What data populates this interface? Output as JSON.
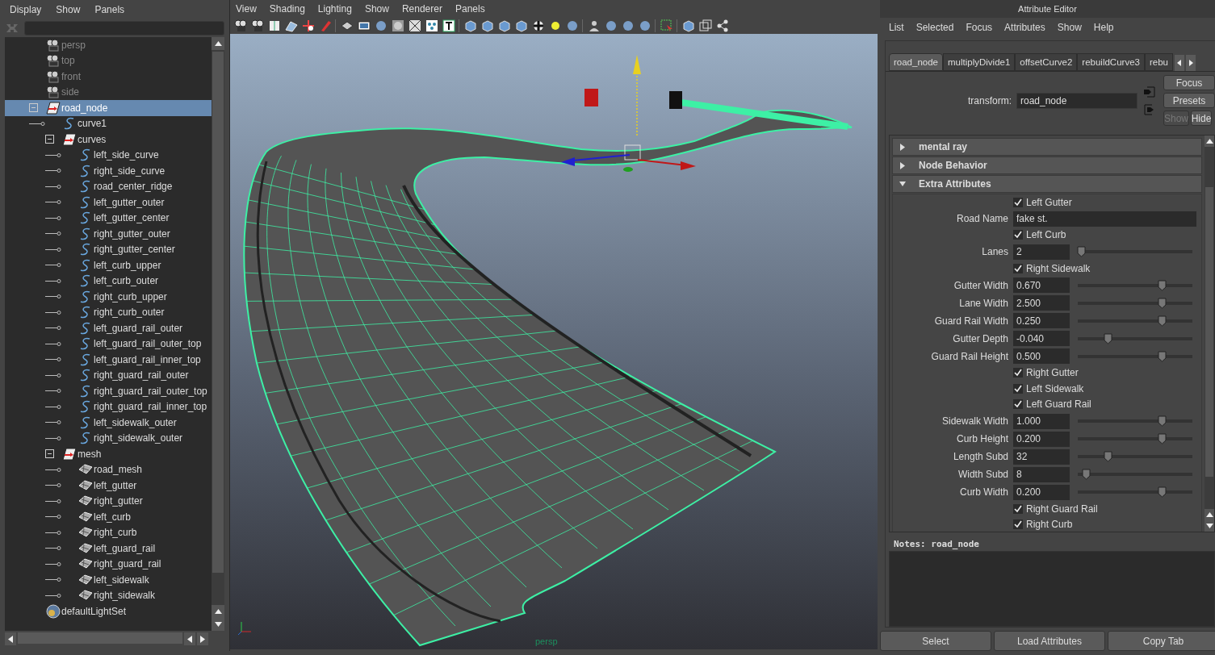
{
  "outliner": {
    "menu": [
      "Display",
      "Show",
      "Panels"
    ],
    "tree": [
      {
        "name": "persp",
        "kind": "camera",
        "selected": false
      },
      {
        "name": "top",
        "kind": "camera",
        "selected": false
      },
      {
        "name": "front",
        "kind": "camera",
        "selected": false
      },
      {
        "name": "side",
        "kind": "camera",
        "selected": false
      },
      {
        "name": "road_node",
        "kind": "transform",
        "selected": true,
        "expanded": true,
        "children": [
          {
            "name": "curve1",
            "kind": "curve",
            "selected": false
          },
          {
            "name": "curves",
            "kind": "transform",
            "selected": false,
            "expanded": true,
            "children": [
              {
                "name": "left_side_curve",
                "kind": "curve",
                "selected": false
              },
              {
                "name": "right_side_curve",
                "kind": "curve",
                "selected": false
              },
              {
                "name": "road_center_ridge",
                "kind": "curve",
                "selected": false
              },
              {
                "name": "left_gutter_outer",
                "kind": "curve",
                "selected": false
              },
              {
                "name": "left_gutter_center",
                "kind": "curve",
                "selected": false
              },
              {
                "name": "right_gutter_outer",
                "kind": "curve",
                "selected": false
              },
              {
                "name": "right_gutter_center",
                "kind": "curve",
                "selected": false
              },
              {
                "name": "left_curb_upper",
                "kind": "curve",
                "selected": false
              },
              {
                "name": "left_curb_outer",
                "kind": "curve",
                "selected": false
              },
              {
                "name": "right_curb_upper",
                "kind": "curve",
                "selected": false
              },
              {
                "name": "right_curb_outer",
                "kind": "curve",
                "selected": false
              },
              {
                "name": "left_guard_rail_outer",
                "kind": "curve",
                "selected": false
              },
              {
                "name": "left_guard_rail_outer_top",
                "kind": "curve",
                "selected": false
              },
              {
                "name": "left_guard_rail_inner_top",
                "kind": "curve",
                "selected": false
              },
              {
                "name": "right_guard_rail_outer",
                "kind": "curve",
                "selected": false
              },
              {
                "name": "right_guard_rail_outer_top",
                "kind": "curve",
                "selected": false
              },
              {
                "name": "right_guard_rail_inner_top",
                "kind": "curve",
                "selected": false
              },
              {
                "name": "left_sidewalk_outer",
                "kind": "curve",
                "selected": false
              },
              {
                "name": "right_sidewalk_outer",
                "kind": "curve",
                "selected": false
              }
            ]
          },
          {
            "name": "mesh",
            "kind": "transform",
            "selected": false,
            "expanded": true,
            "children": [
              {
                "name": "road_mesh",
                "kind": "mesh",
                "selected": false
              },
              {
                "name": "left_gutter",
                "kind": "mesh",
                "selected": false
              },
              {
                "name": "right_gutter",
                "kind": "mesh",
                "selected": false
              },
              {
                "name": "left_curb",
                "kind": "mesh",
                "selected": false
              },
              {
                "name": "right_curb",
                "kind": "mesh",
                "selected": false
              },
              {
                "name": "left_guard_rail",
                "kind": "mesh",
                "selected": false
              },
              {
                "name": "right_guard_rail",
                "kind": "mesh",
                "selected": false
              },
              {
                "name": "left_sidewalk",
                "kind": "mesh",
                "selected": false
              },
              {
                "name": "right_sidewalk",
                "kind": "mesh",
                "selected": false
              }
            ]
          }
        ]
      },
      {
        "name": "defaultLightSet",
        "kind": "lightset",
        "selected": false
      }
    ]
  },
  "viewport": {
    "menu": [
      "View",
      "Shading",
      "Lighting",
      "Show",
      "Renderer",
      "Panels"
    ],
    "camera_label": "persp"
  },
  "attribute_editor": {
    "title": "Attribute Editor",
    "menu": [
      "List",
      "Selected",
      "Focus",
      "Attributes",
      "Show",
      "Help"
    ],
    "tabs": [
      {
        "label": "road_node",
        "selected": true
      },
      {
        "label": "multiplyDivide1",
        "selected": false
      },
      {
        "label": "offsetCurve2",
        "selected": false
      },
      {
        "label": "rebuildCurve3",
        "selected": false
      },
      {
        "label": "rebu",
        "selected": false
      }
    ],
    "transform_label": "transform:",
    "transform_value": "road_node",
    "buttons": [
      {
        "label": "Focus",
        "disabled": false
      },
      {
        "label": "Presets",
        "disabled": false
      },
      {
        "label": "Show",
        "disabled": true
      },
      {
        "label": "Hide",
        "disabled": false
      }
    ],
    "sections": [
      {
        "title": "mental ray",
        "expanded": false
      },
      {
        "title": "Node Behavior",
        "expanded": false
      },
      {
        "title": "Extra Attributes",
        "expanded": true
      }
    ],
    "attributes": [
      {
        "kind": "checkbox",
        "label": "Left Gutter",
        "checked": true
      },
      {
        "kind": "text",
        "label": "Road Name",
        "value": "fake st."
      },
      {
        "kind": "checkbox",
        "label": "Left Curb",
        "checked": true
      },
      {
        "kind": "slider",
        "label": "Lanes",
        "value": "2",
        "level": 0.03
      },
      {
        "kind": "checkbox",
        "label": "Right Sidewalk",
        "checked": true
      },
      {
        "kind": "slider",
        "label": "Gutter Width",
        "value": "0.670",
        "level": 0.73
      },
      {
        "kind": "slider",
        "label": "Lane Width",
        "value": "2.500",
        "level": 0.73
      },
      {
        "kind": "slider",
        "label": "Guard Rail Width",
        "value": "0.250",
        "level": 0.73
      },
      {
        "kind": "slider",
        "label": "Gutter Depth",
        "value": "-0.040",
        "level": 0.26
      },
      {
        "kind": "slider",
        "label": "Guard Rail Height",
        "value": "0.500",
        "level": 0.73
      },
      {
        "kind": "checkbox",
        "label": "Right Gutter",
        "checked": true
      },
      {
        "kind": "checkbox",
        "label": "Left Sidewalk",
        "checked": true
      },
      {
        "kind": "checkbox",
        "label": "Left Guard Rail",
        "checked": true
      },
      {
        "kind": "slider",
        "label": "Sidewalk Width",
        "value": "1.000",
        "level": 0.73
      },
      {
        "kind": "slider",
        "label": "Curb Height",
        "value": "0.200",
        "level": 0.73
      },
      {
        "kind": "slider",
        "label": "Length Subd",
        "value": "32",
        "level": 0.26
      },
      {
        "kind": "slider",
        "label": "Width Subd",
        "value": "8",
        "level": 0.07
      },
      {
        "kind": "slider",
        "label": "Curb Width",
        "value": "0.200",
        "level": 0.73
      },
      {
        "kind": "checkbox",
        "label": "Right Guard Rail",
        "checked": true
      },
      {
        "kind": "checkbox",
        "label": "Right Curb",
        "checked": true
      }
    ],
    "notes_label": "Notes:  road_node",
    "footer_buttons": [
      "Select",
      "Load Attributes",
      "Copy Tab"
    ]
  }
}
